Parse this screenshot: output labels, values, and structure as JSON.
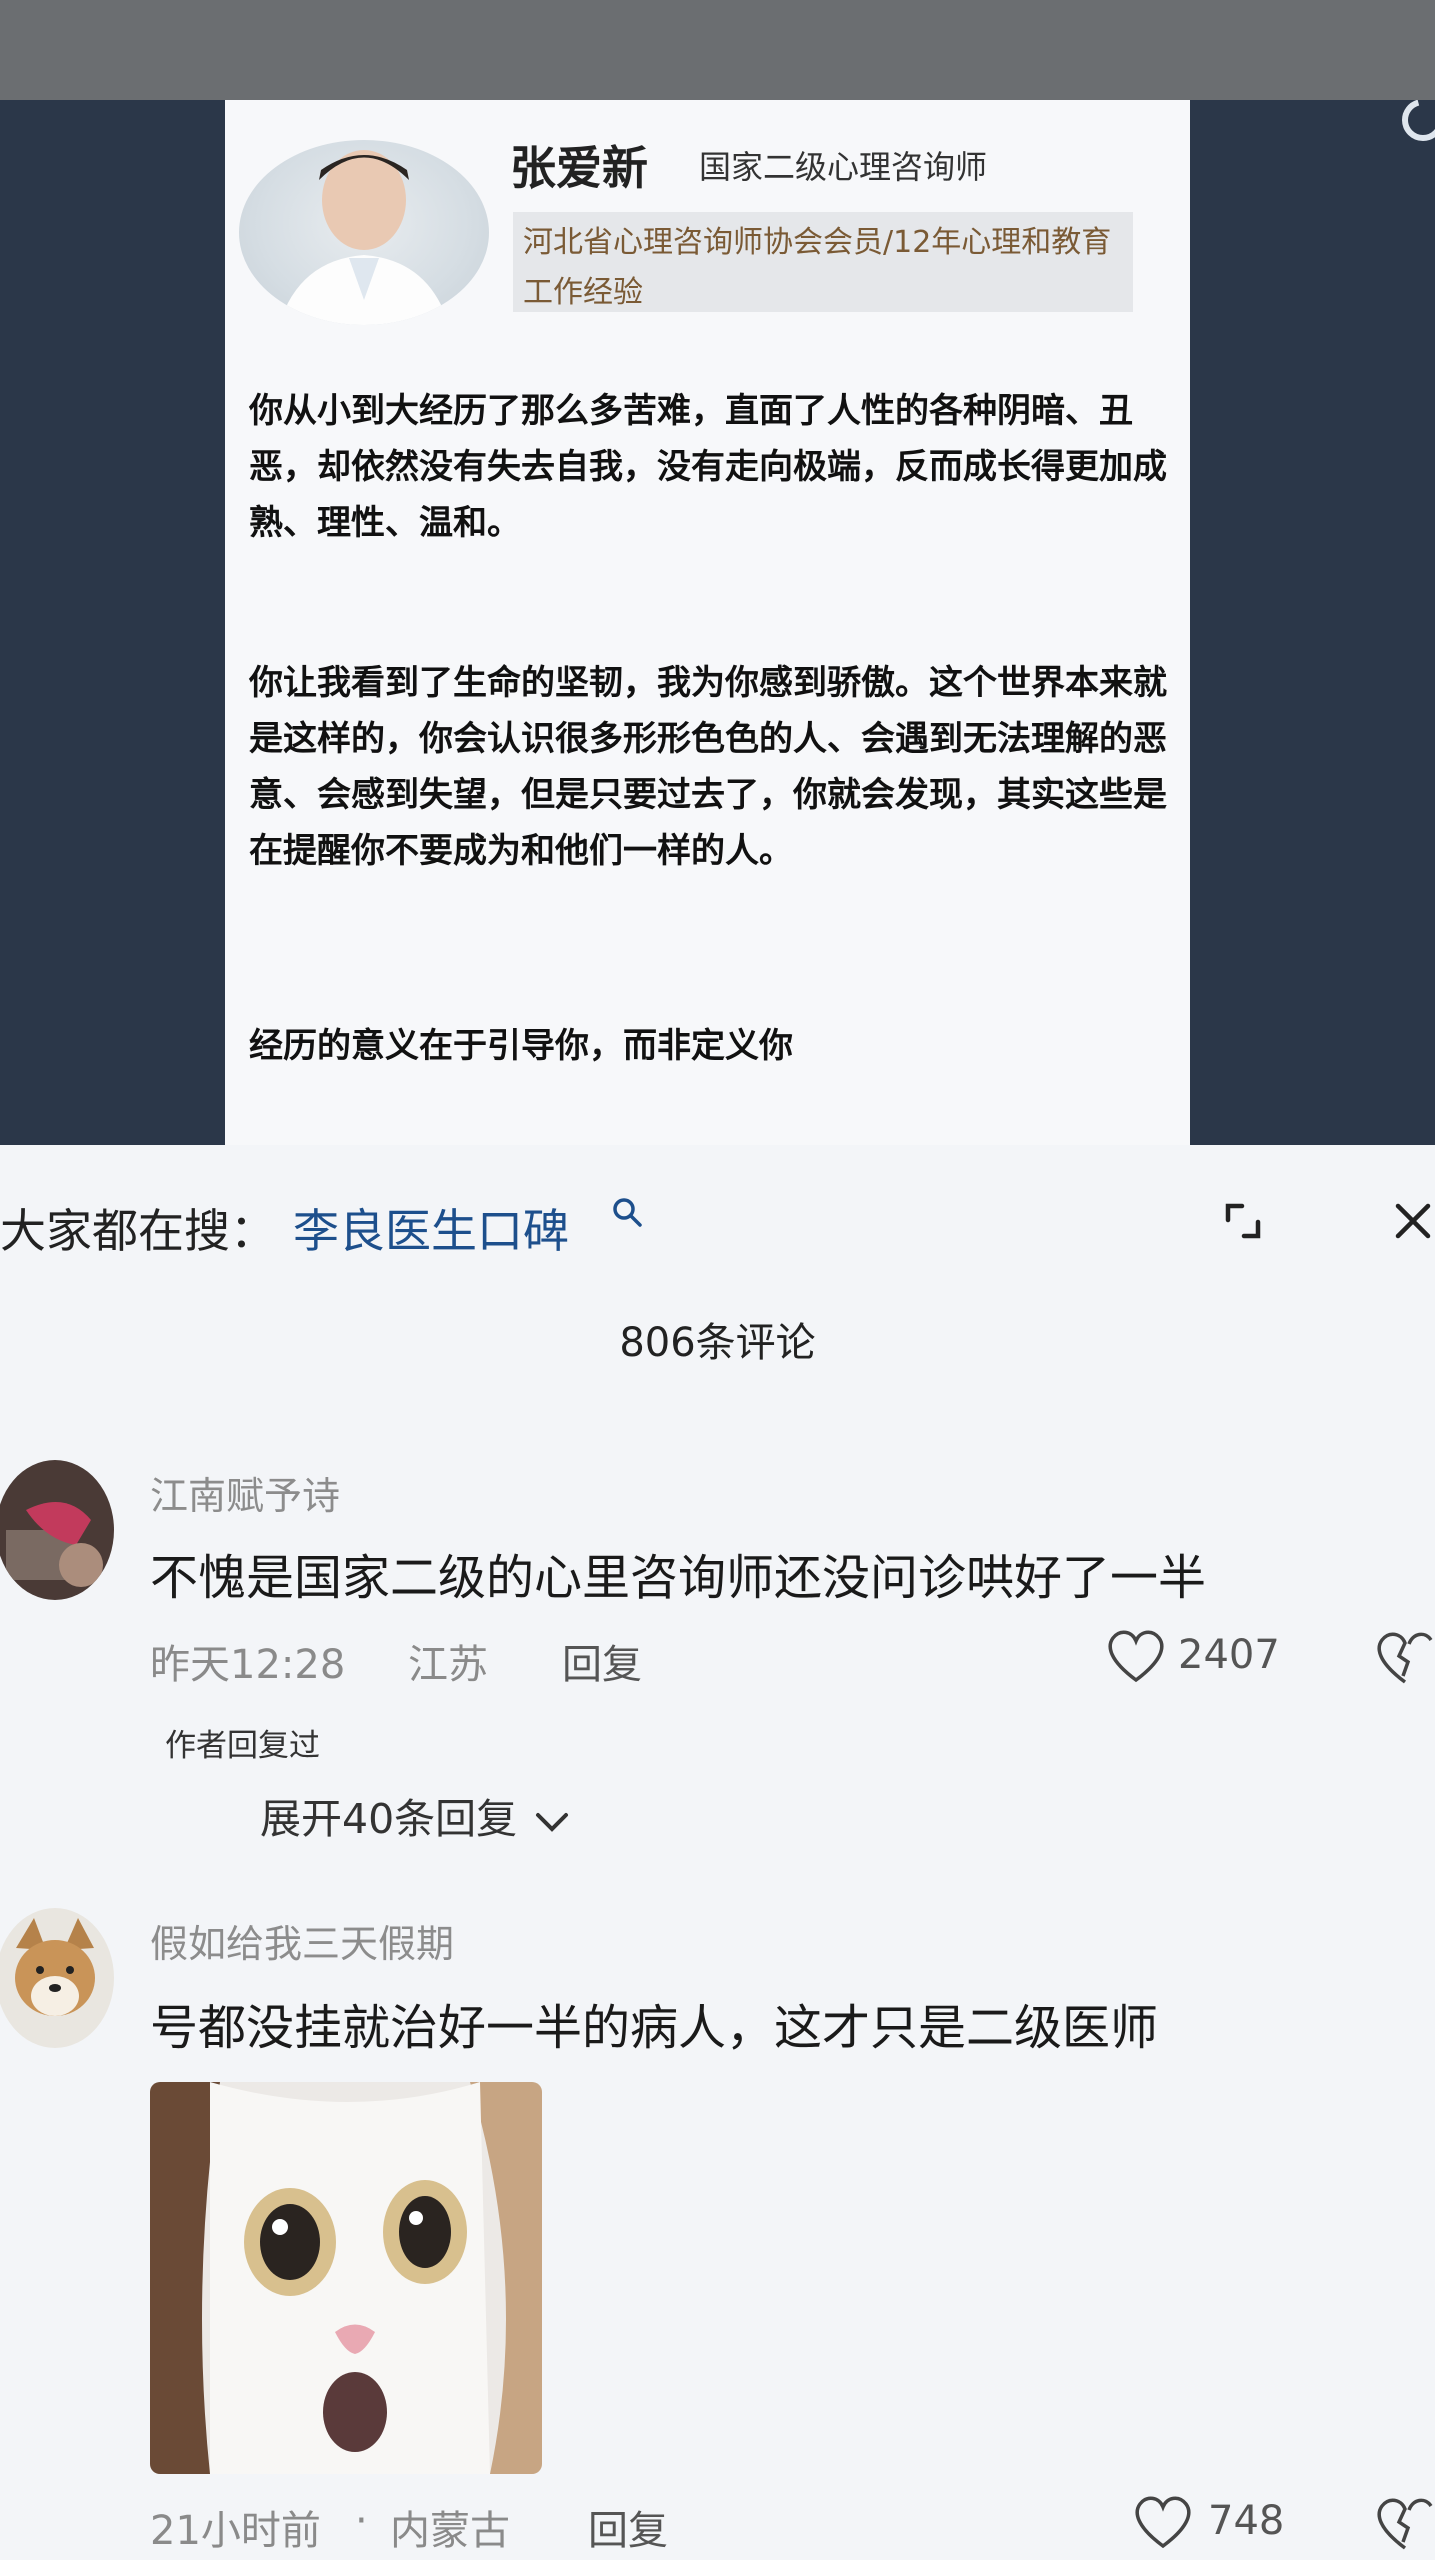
{
  "doctor": {
    "name": "张爱新",
    "title": "国家二级心理咨询师",
    "membership": "河北省心理咨询师协会会员/12年心理和教育工作经验"
  },
  "letter": {
    "paragraph1": "你从小到大经历了那么多苦难，直面了人性的各种阴暗、丑恶，却依然没有失去自我，没有走向极端，反而成长得更加成熟、理性、温和。",
    "paragraph2": "你让我看到了生命的坚韧，我为你感到骄傲。这个世界本来就是这样的，你会认识很多形形色色的人、会遇到无法理解的恶意、会感到失望，但是只要过去了，你就会发现，其实这些是在提醒你不要成为和他们一样的人。",
    "paragraph3": "经历的意义在于引导你，而非定义你"
  },
  "search": {
    "label": "大家都在搜：",
    "query": "李良医生口碑",
    "icon": "search-icon"
  },
  "comments_header": {
    "count_label": "806条评论"
  },
  "comments": [
    {
      "username": "江南赋予诗",
      "text": "不愧是国家二级的心里咨询师还没问诊哄好了一半",
      "time": "昨天12:28",
      "location": "江苏",
      "reply_label": "回复",
      "likes": "2407",
      "author_replied": "作者回复过",
      "expand_replies": "展开40条回复"
    },
    {
      "username": "假如给我三天假期",
      "text": "号都没挂就治好一半的病人，这才只是二级医师",
      "time": "21小时前",
      "separator": "·",
      "location": "内蒙古",
      "reply_label": "回复",
      "likes": "748"
    }
  ],
  "colors": {
    "query_link": "#1d4f8c",
    "video_bg": "#2b3749",
    "page_bg": "#f3f5f8"
  }
}
